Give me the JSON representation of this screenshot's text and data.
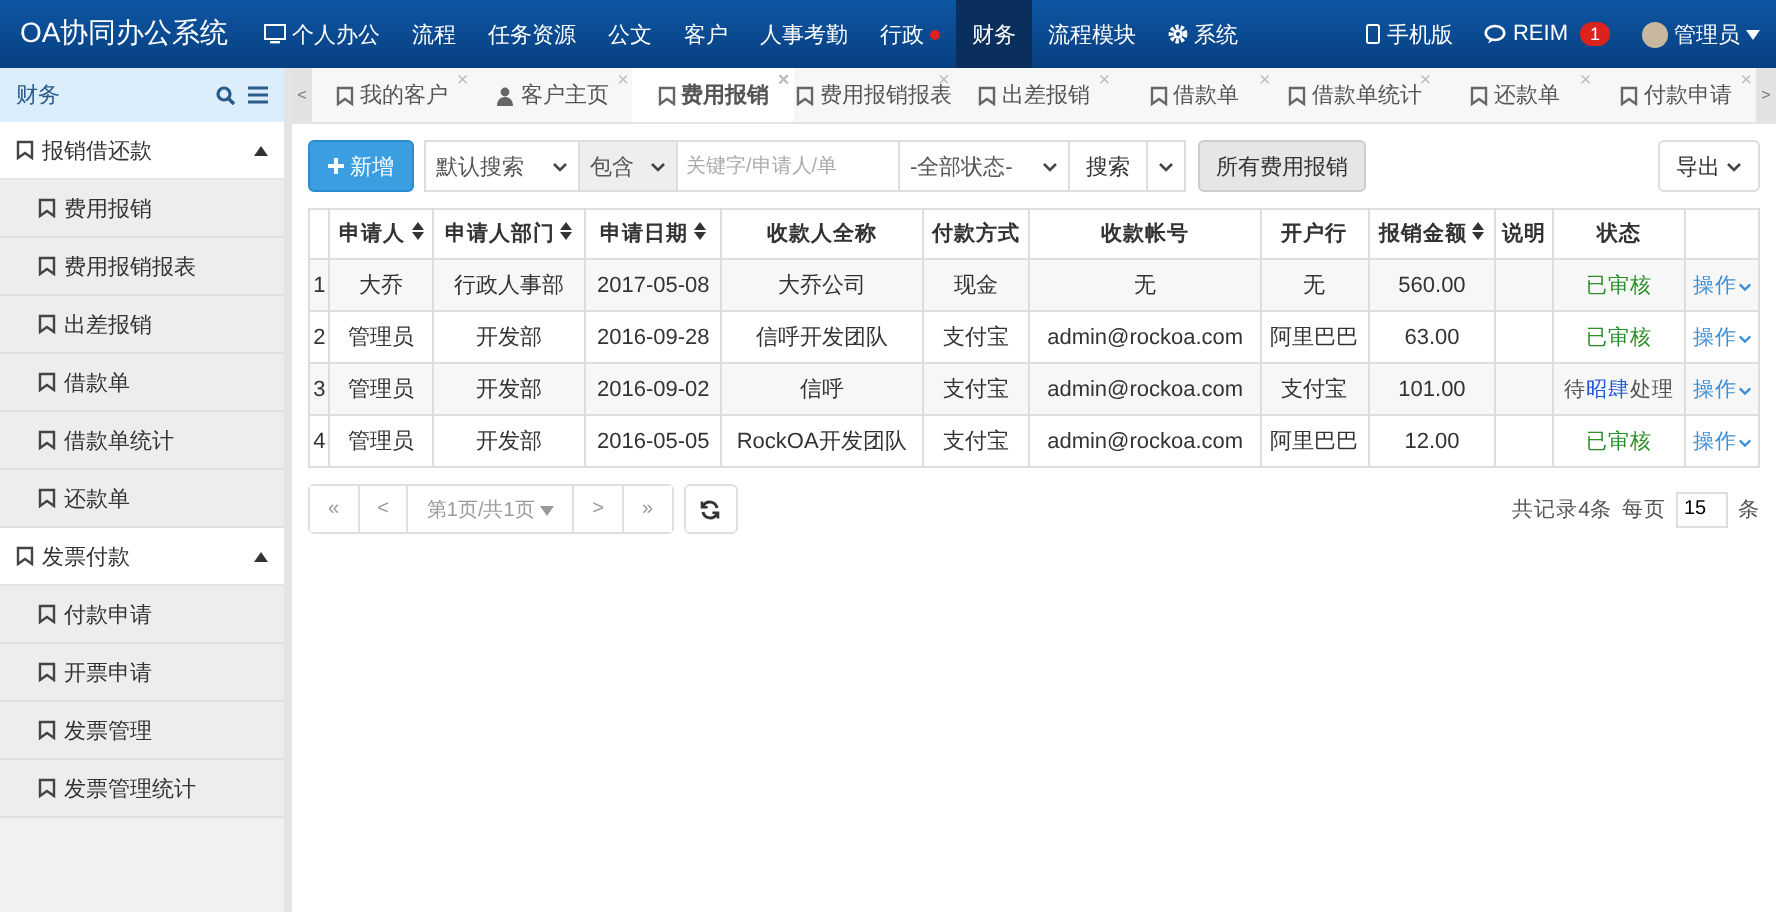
{
  "app_title": "OA协同办公系统",
  "nav": {
    "items": [
      {
        "label": "个人办公",
        "dot": false,
        "selected": false
      },
      {
        "label": "流程",
        "dot": false,
        "selected": false
      },
      {
        "label": "任务资源",
        "dot": false,
        "selected": false
      },
      {
        "label": "公文",
        "dot": false,
        "selected": false
      },
      {
        "label": "客户",
        "dot": false,
        "selected": false
      },
      {
        "label": "人事考勤",
        "dot": false,
        "selected": false
      },
      {
        "label": "行政",
        "dot": true,
        "selected": false
      },
      {
        "label": "财务",
        "dot": false,
        "selected": true
      },
      {
        "label": "流程模块",
        "dot": false,
        "selected": false
      },
      {
        "label": "系统",
        "dot": false,
        "selected": false
      }
    ],
    "right": [
      {
        "label": "手机版"
      },
      {
        "label": "REIM",
        "badge": "1"
      }
    ],
    "user": "管理员"
  },
  "sidebar": {
    "title": "财务",
    "groups": [
      {
        "label": "报销借还款",
        "expanded": true,
        "children": [
          {
            "label": "费用报销"
          },
          {
            "label": "费用报销报表"
          },
          {
            "label": "出差报销"
          },
          {
            "label": "借款单"
          },
          {
            "label": "借款单统计"
          },
          {
            "label": "还款单"
          }
        ]
      },
      {
        "label": "发票付款",
        "expanded": true,
        "children": [
          {
            "label": "付款申请"
          },
          {
            "label": "开票申请"
          },
          {
            "label": "发票管理"
          },
          {
            "label": "发票管理统计"
          }
        ]
      }
    ]
  },
  "tab_bar": {
    "scroll_left": "<",
    "scroll_right": ">"
  },
  "tabs": [
    {
      "label": "我的客户",
      "close": "×",
      "selected": false
    },
    {
      "label": "客户主页",
      "close": "×",
      "selected": false
    },
    {
      "label": "费用报销",
      "close": "×",
      "selected": true
    },
    {
      "label": "费用报销报表",
      "close": "×",
      "selected": false
    },
    {
      "label": "出差报销",
      "close": "×",
      "selected": false
    },
    {
      "label": "借款单",
      "close": "×",
      "selected": false
    },
    {
      "label": "借款单统计",
      "close": "×",
      "selected": false
    },
    {
      "label": "还款单",
      "close": "×",
      "selected": false
    },
    {
      "label": "付款申请",
      "close": "×",
      "selected": false
    }
  ],
  "toolbar": {
    "add": "新增",
    "search_type": "默认搜索",
    "match": "包含",
    "keyword_placeholder": "关键字/申请人/单",
    "status_filter": "-全部状态-",
    "search": "搜索",
    "all_button": "所有费用报销",
    "export": "导出"
  },
  "table": {
    "columns": [
      {
        "sortable": false
      },
      {
        "label": "申请人",
        "sortable": true
      },
      {
        "label": "申请人部门",
        "sortable": true
      },
      {
        "label": "申请日期",
        "sortable": true
      },
      {
        "label": "收款人全称",
        "sortable": false
      },
      {
        "label": "付款方式",
        "sortable": false
      },
      {
        "label": "收款帐号",
        "sortable": false
      },
      {
        "label": "开户行",
        "sortable": false
      },
      {
        "label": "报销金额",
        "sortable": true
      },
      {
        "label": "说明",
        "sortable": false
      },
      {
        "label": "状态",
        "sortable": false
      },
      {
        "sortable": false
      }
    ],
    "rows": [
      {
        "index": "1",
        "applicant": "大乔",
        "dept": "行政人事部",
        "date": "2017-05-08",
        "payee": "大乔公司",
        "method": "现金",
        "account": "无",
        "bank": "无",
        "amount": "560.00",
        "status": {
          "kind": "approved",
          "parts": [
            "已审核"
          ]
        },
        "action": "操作"
      },
      {
        "index": "2",
        "applicant": "管理员",
        "dept": "开发部",
        "date": "2016-09-28",
        "payee": "信呼开发团队",
        "method": "支付宝",
        "account": "admin@rockoa.com",
        "bank": "阿里巴巴",
        "amount": "63.00",
        "status": {
          "kind": "approved",
          "parts": [
            "已审核"
          ]
        },
        "action": "操作"
      },
      {
        "index": "3",
        "applicant": "管理员",
        "dept": "开发部",
        "date": "2016-09-02",
        "payee": "信呼",
        "method": "支付宝",
        "account": "admin@rockoa.com",
        "bank": "支付宝",
        "amount": "101.00",
        "status": {
          "kind": "pending",
          "parts": [
            "待",
            "昭肆",
            "处理"
          ]
        },
        "action": "操作"
      },
      {
        "index": "4",
        "applicant": "管理员",
        "dept": "开发部",
        "date": "2016-05-05",
        "payee": "RockOA开发团队",
        "method": "支付宝",
        "account": "admin@rockoa.com",
        "bank": "阿里巴巴",
        "amount": "12.00",
        "status": {
          "kind": "approved",
          "parts": [
            "已审核"
          ]
        },
        "action": "操作"
      }
    ]
  },
  "pager": {
    "first": "«",
    "prev": "<",
    "page": "第1页/共1页",
    "next": ">",
    "last": "»",
    "total": "共记录4条",
    "per_page_label": "每页",
    "per_page": "15",
    "unit": "条"
  }
}
